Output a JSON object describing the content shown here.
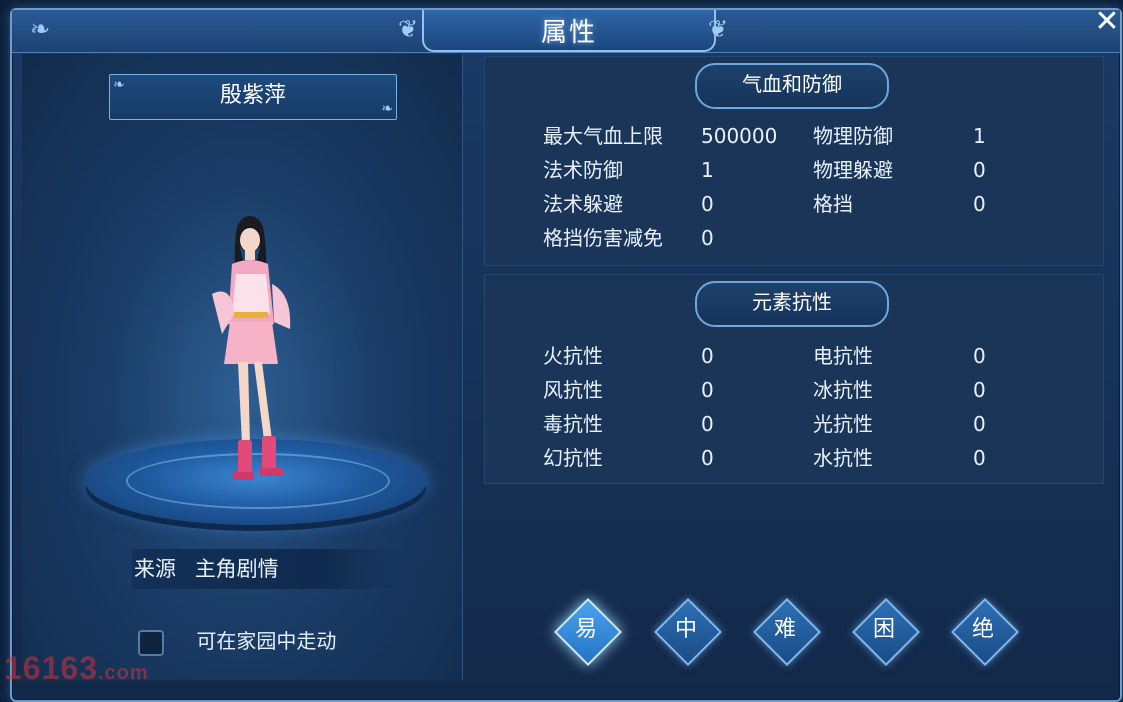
{
  "window": {
    "title": "属性"
  },
  "character": {
    "name": "殷紫萍"
  },
  "source": {
    "label": "来源",
    "value": "主角剧情"
  },
  "home_walk": {
    "label": "可在家园中走动",
    "checked": false
  },
  "hp_defense": {
    "title": "气血和防御",
    "rows": [
      {
        "l1": "最大气血上限",
        "v1": "500000",
        "l2": "物理防御",
        "v2": "1"
      },
      {
        "l1": "法术防御",
        "v1": "1",
        "l2": "物理躲避",
        "v2": "0"
      },
      {
        "l1": "法术躲避",
        "v1": "0",
        "l2": "格挡",
        "v2": "0"
      },
      {
        "l1": "格挡伤害减免",
        "v1": "0",
        "l2": "",
        "v2": ""
      }
    ]
  },
  "elemental": {
    "title": "元素抗性",
    "rows": [
      {
        "l1": "火抗性",
        "v1": "0",
        "l2": "电抗性",
        "v2": "0"
      },
      {
        "l1": "风抗性",
        "v1": "0",
        "l2": "冰抗性",
        "v2": "0"
      },
      {
        "l1": "毒抗性",
        "v1": "0",
        "l2": "光抗性",
        "v2": "0"
      },
      {
        "l1": "幻抗性",
        "v1": "0",
        "l2": "水抗性",
        "v2": "0"
      }
    ]
  },
  "difficulty": {
    "options": [
      "易",
      "中",
      "难",
      "困",
      "绝"
    ],
    "selected": "易"
  },
  "watermark": {
    "main": "16163",
    "suffix": ".com"
  },
  "icons": {
    "close": "close-icon",
    "ornament": "ornament-icon",
    "checkbox": "checkbox-icon"
  }
}
